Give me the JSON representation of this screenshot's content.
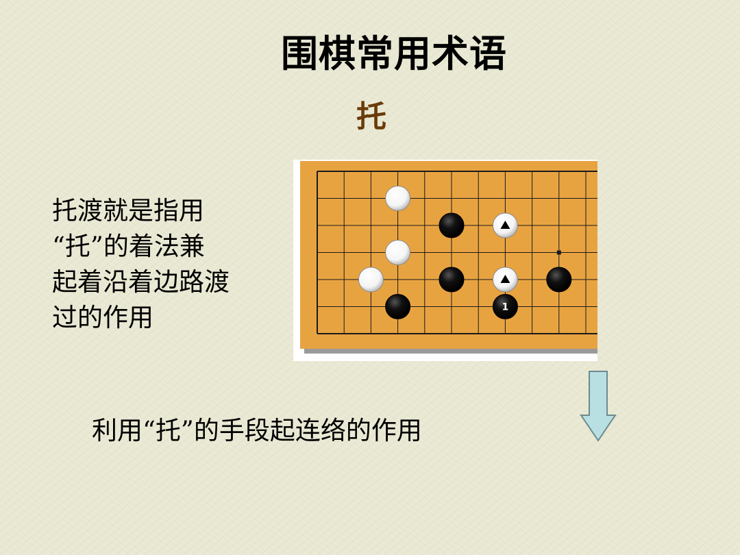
{
  "title": "围棋常用术语",
  "subtitle": "托",
  "description_lines": [
    "托渡就是指用",
    "“托”的着法兼",
    "起着沿着边路渡",
    "过的作用"
  ],
  "caption": "利用“托”的手段起连络的作用",
  "board": {
    "colors": {
      "wood": "#e8a341",
      "line": "#1a1a1a",
      "black_stone": "#111111",
      "white_stone": "#f4f4f4"
    },
    "stones": [
      {
        "color": "white",
        "col": 3,
        "row": 1,
        "mark": ""
      },
      {
        "color": "black",
        "col": 5,
        "row": 2,
        "mark": ""
      },
      {
        "color": "white",
        "col": 7,
        "row": 2,
        "mark": "triangle"
      },
      {
        "color": "white",
        "col": 3,
        "row": 3,
        "mark": ""
      },
      {
        "color": "white",
        "col": 2,
        "row": 4,
        "mark": ""
      },
      {
        "color": "black",
        "col": 5,
        "row": 4,
        "mark": ""
      },
      {
        "color": "white",
        "col": 7,
        "row": 4,
        "mark": "triangle"
      },
      {
        "color": "black",
        "col": 9,
        "row": 4,
        "mark": ""
      },
      {
        "color": "black",
        "col": 3,
        "row": 5,
        "mark": ""
      },
      {
        "color": "black",
        "col": 7,
        "row": 5,
        "mark": "1"
      }
    ],
    "star_point": {
      "col": 9,
      "row": 3
    }
  },
  "arrow": {
    "color": "#b8dfe2",
    "direction": "down"
  }
}
